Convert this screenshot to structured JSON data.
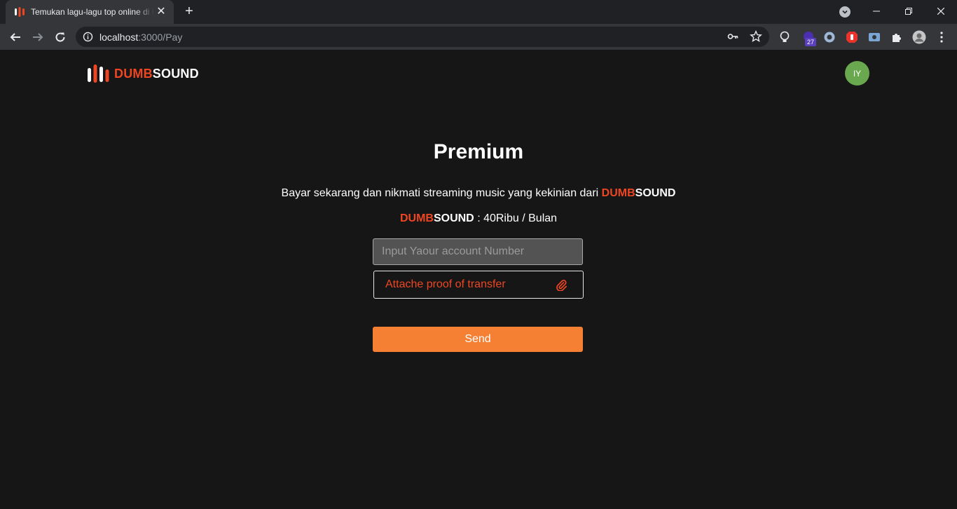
{
  "browser": {
    "tab_title": "Temukan lagu-lagu top online di DUMBSOUND",
    "tab_close": "✕",
    "new_tab": "+",
    "url_host": "localhost",
    "url_path": ":3000/Pay",
    "extension_badge": "27",
    "window_controls": {
      "minimize": "—",
      "restore": "❐",
      "close": "✕"
    }
  },
  "header": {
    "brand_red": "DUMB",
    "brand_white": "SOUND",
    "avatar_initials": "IY",
    "avatar_color": "#6aa84f"
  },
  "main": {
    "title": "Premium",
    "description": "Bayar sekarang dan nikmati streaming music yang kekinian dari",
    "description_brand_red": "DUMB",
    "description_brand_white": "SOUND",
    "price_brand_red": "DUMB",
    "price_brand_white": "SOUND",
    "price_text": ": 40Ribu / Bulan",
    "account_input": {
      "placeholder": "Input Yaour account Number",
      "value": ""
    },
    "attach_label": "Attache proof of transfer",
    "send_label": "Send"
  },
  "colors": {
    "background": "#161616",
    "accent_red": "#ee4622",
    "button_orange": "#f58033"
  },
  "icons": {
    "attach": "paperclip-icon",
    "logo": "dumbsound-logo-icon"
  }
}
